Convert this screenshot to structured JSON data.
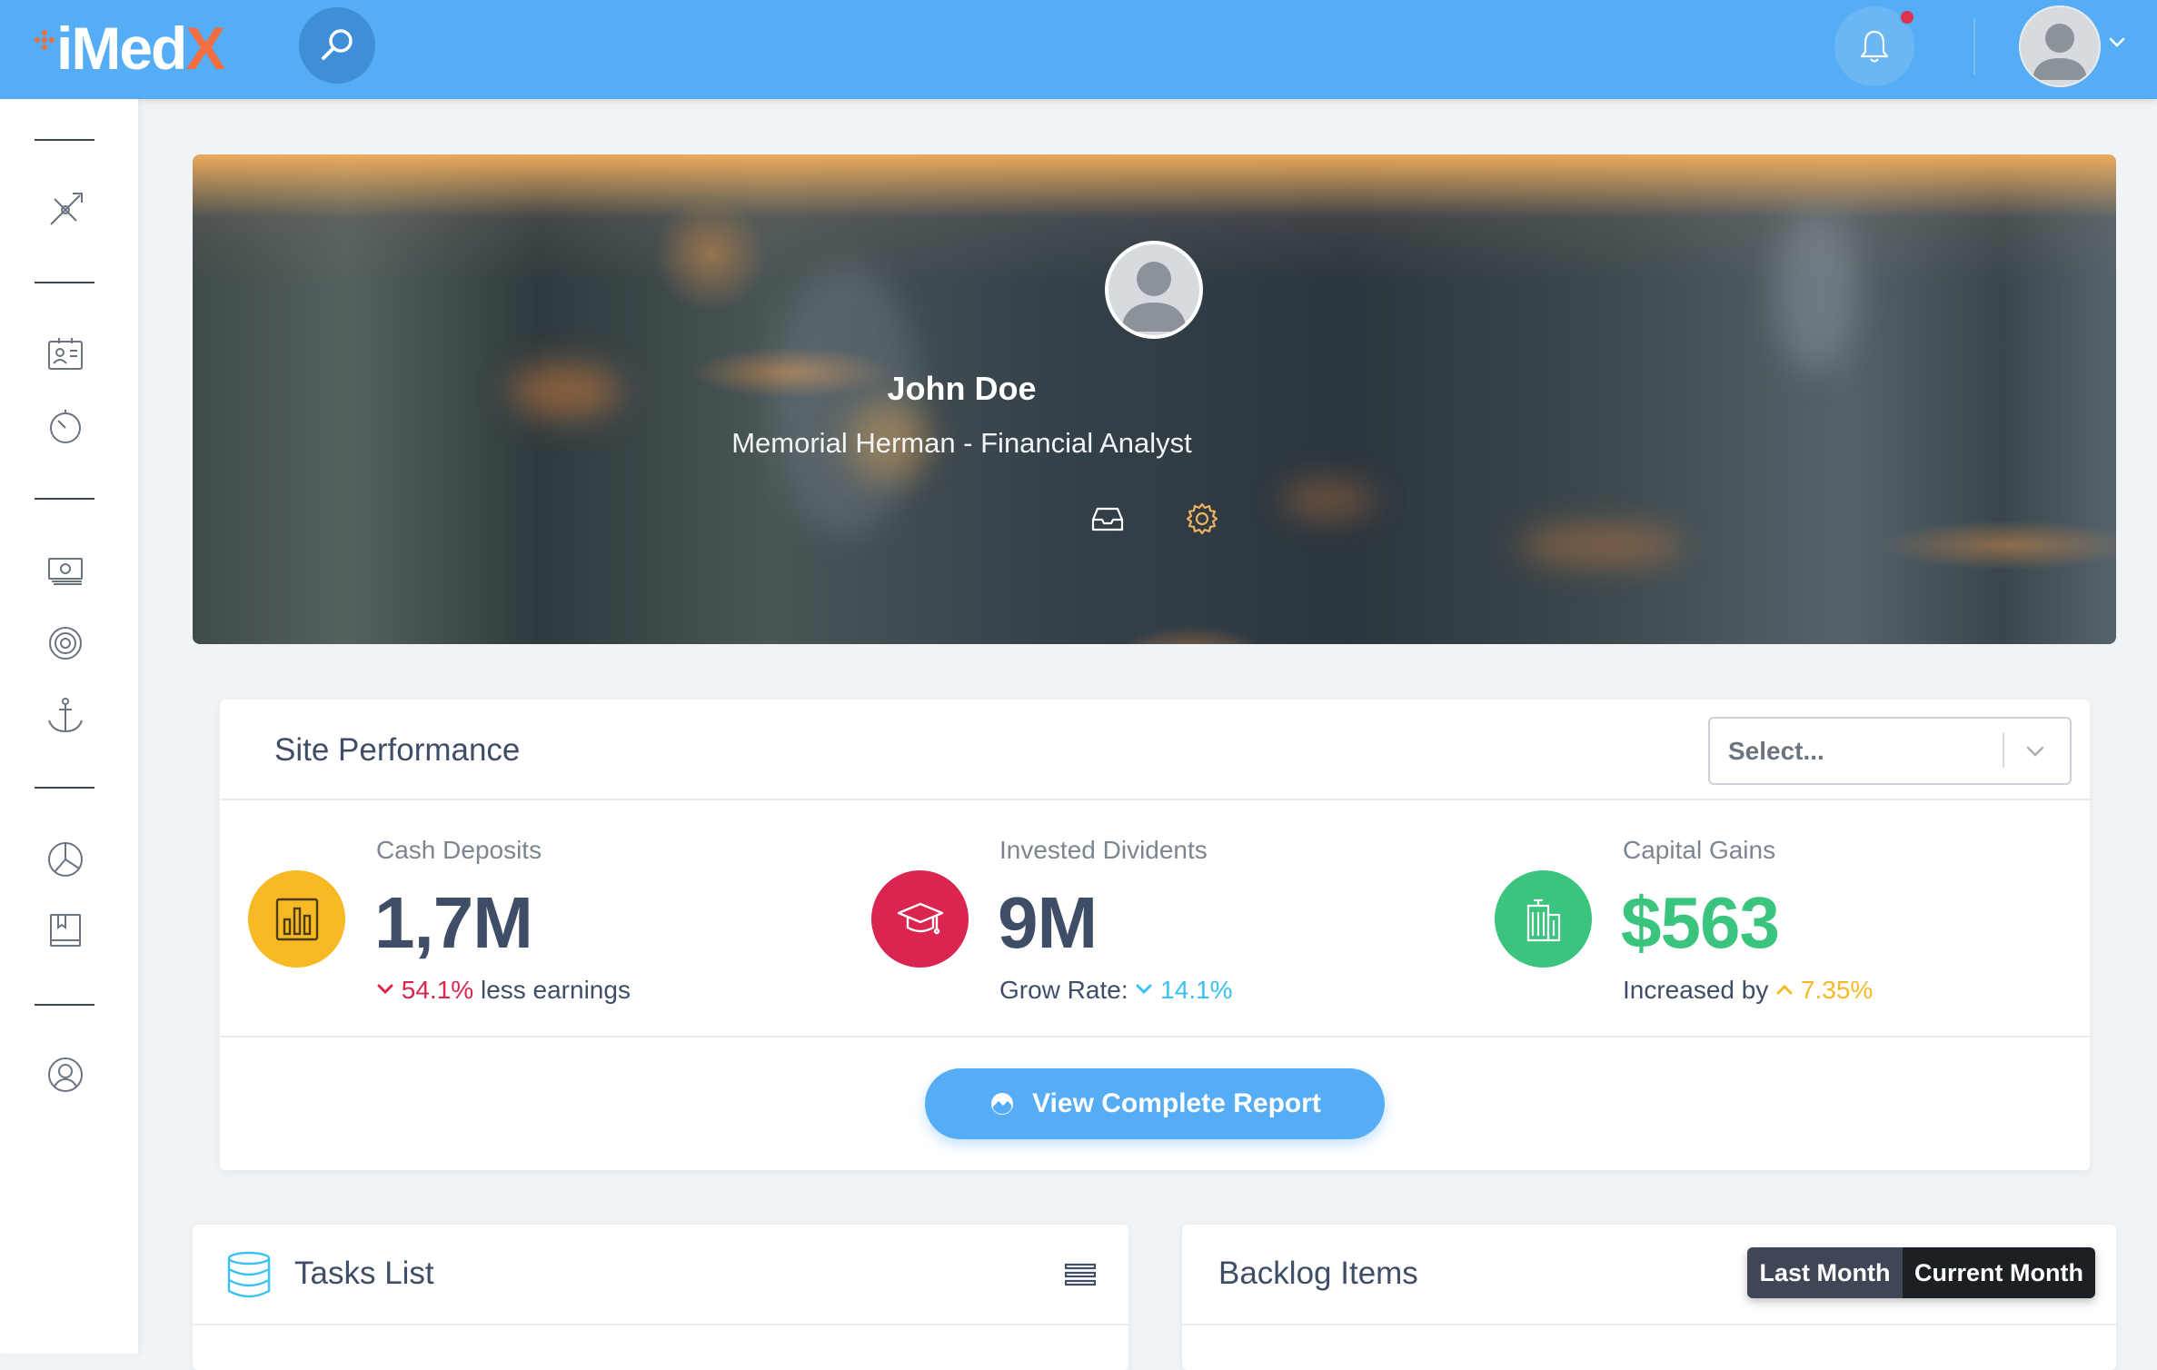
{
  "app": {
    "logo_main": "iMed",
    "logo_accent": "X"
  },
  "header": {
    "notifications": "bell-icon",
    "search": "search-icon"
  },
  "sidebar": {
    "icons": [
      "compass-icon",
      "id-card-icon",
      "timer-icon",
      "money-icon",
      "target-icon",
      "anchor-icon",
      "pie-chart-icon",
      "book-icon",
      "user-circle-icon"
    ]
  },
  "profile": {
    "name": "John Doe",
    "subtitle": "Memorial Herman - Financial Analyst",
    "actions": [
      "inbox-icon",
      "settings-icon"
    ]
  },
  "site_performance": {
    "title": "Site Performance",
    "select_placeholder": "Select...",
    "metrics": [
      {
        "label": "Cash Deposits",
        "value": "1,7M",
        "change": "54.1%",
        "change_text": "less earnings",
        "icon": "bar-chart-icon",
        "color": "#f7b924"
      },
      {
        "label": "Invested Dividents",
        "value": "9M",
        "prefix": "Grow Rate:",
        "change": "14.1%",
        "icon": "graduation-cap-icon",
        "color": "#d92550"
      },
      {
        "label": "Capital Gains",
        "value": "$563",
        "prefix": "Increased by",
        "change": "7.35%",
        "icon": "building-icon",
        "color": "#3ac47d"
      }
    ],
    "button_label": "View Complete Report"
  },
  "tasks": {
    "title": "Tasks List"
  },
  "backlog": {
    "title": "Backlog Items",
    "tabs": [
      "Last Month",
      "Current Month"
    ]
  },
  "colors": {
    "header": "#55adf6",
    "accent_orange": "#f36d3f",
    "success": "#3ac47d",
    "danger": "#d92550",
    "warning": "#f7b924",
    "info": "#3ac0f4"
  }
}
